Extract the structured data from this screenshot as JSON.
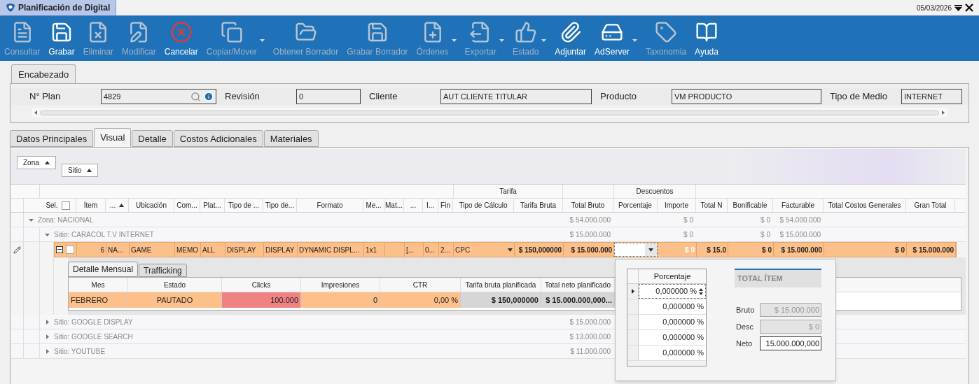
{
  "window": {
    "title": "Planificación de Digital",
    "date": "05/03/2026"
  },
  "toolbar": {
    "buttons": [
      {
        "label": "Consultar",
        "enabled": false,
        "dropdown": false
      },
      {
        "label": "Grabar",
        "enabled": true,
        "dropdown": false
      },
      {
        "label": "Eliminar",
        "enabled": false,
        "dropdown": false
      },
      {
        "label": "Modificar",
        "enabled": false,
        "dropdown": false
      },
      {
        "label": "Cancelar",
        "enabled": true,
        "dropdown": false
      },
      {
        "label": "Copiar/Mover",
        "enabled": false,
        "dropdown": true
      },
      {
        "label": "Obtener Borrador",
        "enabled": false,
        "dropdown": false
      },
      {
        "label": "Grabar Borrador",
        "enabled": false,
        "dropdown": false
      },
      {
        "label": "Órdenes",
        "enabled": false,
        "dropdown": true
      },
      {
        "label": "Exportar",
        "enabled": false,
        "dropdown": true
      },
      {
        "label": "Estado",
        "enabled": false,
        "dropdown": true
      },
      {
        "label": "Adjuntar",
        "enabled": true,
        "dropdown": false
      },
      {
        "label": "AdServer",
        "enabled": true,
        "dropdown": true
      },
      {
        "label": "Taxonomia",
        "enabled": false,
        "dropdown": false
      },
      {
        "label": "Ayuda",
        "enabled": true,
        "dropdown": false
      }
    ]
  },
  "header": {
    "tab": "Encabezado",
    "fields": [
      {
        "label": "N° Plan",
        "value": "4829",
        "kind": "lookup"
      },
      {
        "label": "Revisión",
        "value": "0",
        "kind": "text"
      },
      {
        "label": "Cliente",
        "value": "AUT CLIENTE TITULAR",
        "kind": "text"
      },
      {
        "label": "Producto",
        "value": "VM PRODUCTO",
        "kind": "text"
      },
      {
        "label": "Tipo de Medio",
        "value": "INTERNET",
        "kind": "text"
      }
    ]
  },
  "tabs": [
    {
      "label": "Datos Principales",
      "selected": false
    },
    {
      "label": "Visual",
      "selected": true
    },
    {
      "label": "Detalle",
      "selected": false
    },
    {
      "label": "Costos Adicionales",
      "selected": false
    },
    {
      "label": "Materiales",
      "selected": false
    }
  ],
  "group_panel": {
    "chips": [
      {
        "label": "Zona",
        "sorted_ascending": true
      },
      {
        "label": "Sitio",
        "sorted_ascending": true
      }
    ]
  },
  "grid": {
    "columns": [
      {
        "label": "Sel.",
        "kind": "select",
        "checked": false
      },
      {
        "label": "Ítem"
      },
      {
        "label": "...",
        "sorted_ascending": true
      },
      {
        "label": "Ubicación"
      },
      {
        "label": "Com..."
      },
      {
        "label": "Plat..."
      },
      {
        "label": "Tipo de ..."
      },
      {
        "label": "Tipo de..."
      },
      {
        "label": "Formato"
      },
      {
        "label": "Me..."
      },
      {
        "label": "Mat..."
      },
      {
        "label": "..."
      },
      {
        "label": "I..."
      },
      {
        "label": "Fin"
      },
      {
        "label": "Tarifa",
        "columns": [
          {
            "label": "Tipo de Cálculo"
          },
          {
            "label": "Tarifa Bruta"
          }
        ]
      },
      {
        "label": "Total Bruto"
      },
      {
        "label": "Descuentos",
        "columns": [
          {
            "label": "Porcentaje"
          },
          {
            "label": "Importe"
          }
        ]
      },
      {
        "label": "Total N"
      },
      {
        "label": "Bonificable"
      },
      {
        "label": "Facturable"
      },
      {
        "label": "Total Costos Generales"
      },
      {
        "label": "Gran Total"
      }
    ],
    "zone": {
      "label": "Zona: NACIONAL",
      "expanded": true,
      "total_bruto": "$ 54.000.000",
      "importe": "$ 0",
      "bonificable": "$ 0",
      "facturable": "$ 54.000.000"
    },
    "sites": [
      {
        "label": "Sitio: CARACOL T.V INTERNET",
        "expanded": true,
        "total_bruto": "$ 15.000.000",
        "importe": "$ 0",
        "bonificable": "$ 0",
        "facturable": "$ 15.000.000",
        "items": [
          {
            "editing": true,
            "expanded": true,
            "checked": false,
            "cells": [
              {
                "kind": "text",
                "text": "6"
              },
              {
                "kind": "text",
                "text": "NA..."
              },
              {
                "kind": "text",
                "text": "GAME"
              },
              {
                "kind": "text",
                "text": "MEMO"
              },
              {
                "kind": "text",
                "text": "ALL"
              },
              {
                "kind": "text",
                "text": "DISPLAY"
              },
              {
                "kind": "text",
                "text": "DISPLAY"
              },
              {
                "kind": "text",
                "text": "DYNAMIC DISPL..."
              },
              {
                "kind": "text",
                "text": "1x1"
              },
              {
                "kind": "empty"
              },
              {
                "kind": "text",
                "text": "[..."
              },
              {
                "kind": "text",
                "text": "0..."
              },
              {
                "kind": "text",
                "text": "2..."
              },
              {
                "kind": "dropdown",
                "text": "CPC"
              },
              {
                "kind": "text",
                "text": "$ 150,000000"
              },
              {
                "kind": "text",
                "text": "$ 15.000.000"
              },
              {
                "kind": "editor"
              },
              {
                "kind": "text",
                "text": "$ 0"
              },
              {
                "kind": "text",
                "text": "$ 15.0"
              },
              {
                "kind": "text",
                "text": "$ 0"
              },
              {
                "kind": "text",
                "text": "$ 15.000.000"
              },
              {
                "kind": "text",
                "text": "$ 0"
              },
              {
                "kind": "text",
                "text": "$ 15.000.000"
              }
            ],
            "detail": {
              "tabs": [
                {
                  "label": "Detalle Mensual",
                  "selected": true
                },
                {
                  "label": "Trafficking",
                  "selected": false
                }
              ],
              "columns": [
                "Mes",
                "Estado",
                "Clicks",
                "Impresiones",
                "CTR",
                "Tarifa bruta planificada",
                "Total neto planificado"
              ],
              "rows": [
                {
                  "cells": [
                    {
                      "text": "FEBRERO",
                      "color": "#fdc08a"
                    },
                    {
                      "text": "PAUTADO",
                      "color": "#fdc08a"
                    },
                    {
                      "text": "100.000",
                      "color": "#f08282"
                    },
                    {
                      "text": "0",
                      "color": "#fdc08a"
                    },
                    {
                      "text": "0,00 %",
                      "color": "#fdc08a"
                    },
                    {
                      "text": "$ 150,000000",
                      "color": "#d6d6d6"
                    },
                    {
                      "text": "$ 15.000.000,000...",
                      "color": "#d6d6d6"
                    }
                  ]
                }
              ]
            }
          }
        ]
      },
      {
        "label": "Sitio: GOOGLE DISPLAY",
        "expanded": false,
        "total_bruto": "$ 15.000.000"
      },
      {
        "label": "Sitio: GOOGLE SEARCH",
        "expanded": false,
        "total_bruto": "$ 13.000.000"
      },
      {
        "label": "Sitio: YOUTUBE",
        "expanded": false,
        "total_bruto": "$ 11.000.000"
      }
    ]
  },
  "popup": {
    "column": "Porcentaje",
    "rows": [
      {
        "value": "0,000000 %",
        "selected": true
      },
      {
        "value": "0,000000 %",
        "selected": false
      },
      {
        "value": "0,000000 %",
        "selected": false
      },
      {
        "value": "0,000000 %",
        "selected": false
      },
      {
        "value": "0,000000 %",
        "selected": false
      }
    ],
    "total": {
      "title": "TOTAL ÍTEM",
      "fields": [
        {
          "label": "Bruto",
          "value": "$ 15.000.000",
          "disabled": true
        },
        {
          "label": "Desc",
          "value": "$ 0",
          "disabled": true
        },
        {
          "label": "Neto",
          "value": "15.000.000,000",
          "disabled": false
        }
      ]
    }
  }
}
